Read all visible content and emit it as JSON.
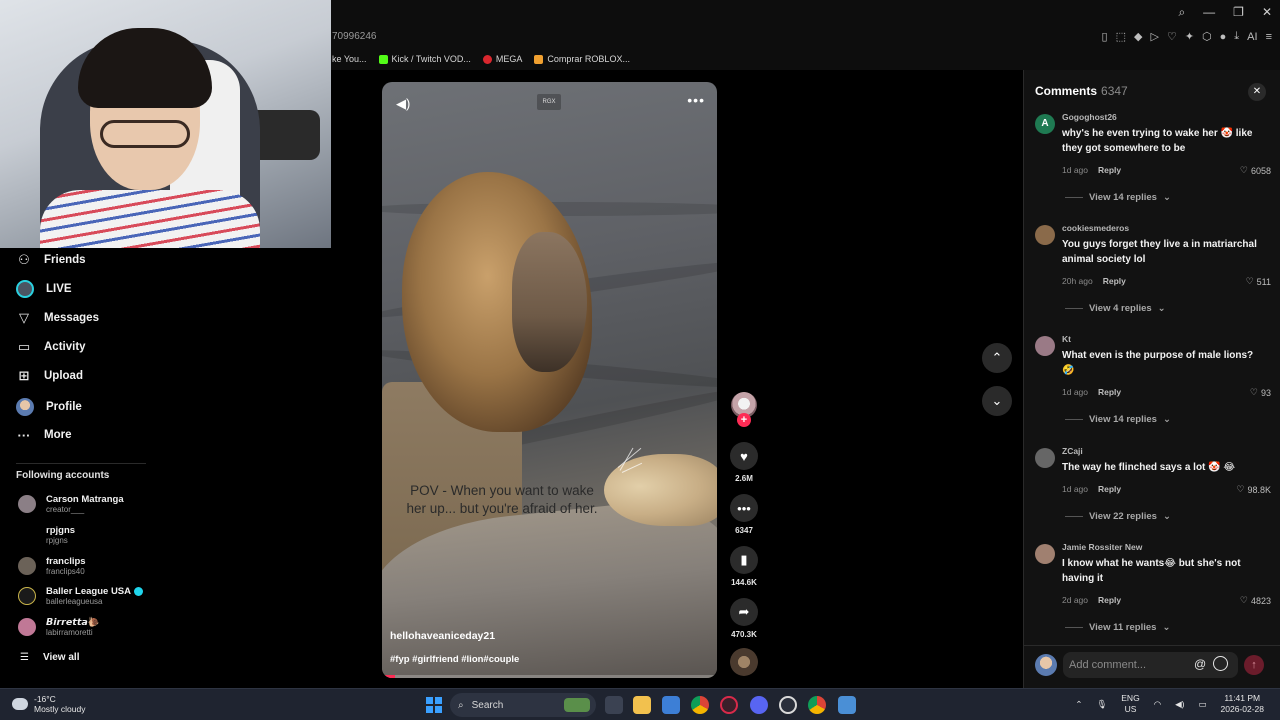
{
  "browser": {
    "url_fragment": "70996246",
    "bookmarks": [
      {
        "label": "ke You...",
        "color": "#d8d8d8"
      },
      {
        "label": "Kick / Twitch VOD...",
        "color": "#53fc18"
      },
      {
        "label": "MEGA",
        "color": "#d9272e"
      },
      {
        "label": "Comprar ROBLOX...",
        "color": "#f0a030"
      }
    ],
    "toolbar_ai_label": "AI"
  },
  "sidebar": {
    "nav": [
      {
        "label": "Friends",
        "icon": "friends-icon"
      },
      {
        "label": "LIVE",
        "icon": "live-icon"
      },
      {
        "label": "Messages",
        "icon": "messages-icon"
      },
      {
        "label": "Activity",
        "icon": "activity-icon"
      },
      {
        "label": "Upload",
        "icon": "upload-icon"
      },
      {
        "label": "Profile",
        "icon": "profile-icon"
      },
      {
        "label": "More",
        "icon": "more-icon"
      }
    ],
    "following_title": "Following accounts",
    "accounts": [
      {
        "name": "Carson Matranga",
        "handle": "creator___",
        "verified": false,
        "color": "#8b7f86"
      },
      {
        "name": "rpjgns",
        "handle": "rpjgns",
        "verified": false,
        "color": "#000000"
      },
      {
        "name": "franclips",
        "handle": "franclips40",
        "verified": false,
        "color": "#6b6258"
      },
      {
        "name": "Baller League USA",
        "handle": "ballerleagueusa",
        "verified": true,
        "color": "#1a1a1a"
      },
      {
        "name": "𝘽𝙞𝙧𝙧𝙚𝙩𝙩𝙖🐌",
        "handle": "labirramoretti",
        "verified": false,
        "color": "#c07896"
      }
    ],
    "view_all": "View all"
  },
  "video": {
    "watermark": "RGX",
    "caption": "POV - When you want to wake her up... but you're afraid of her.",
    "author": "hellohaveaniceday21",
    "tags": "#fyp #girlfriend #lion#couple",
    "progress_fraction": 0.04
  },
  "actions": {
    "likes": "2.6M",
    "comments": "6347",
    "saves": "144.6K",
    "shares": "470.3K"
  },
  "comments_panel": {
    "title": "Comments",
    "count": "6347",
    "input_placeholder": "Add comment...",
    "items": [
      {
        "user": "Gogoghost26",
        "avatar_letter": "A",
        "avatar_color": "#1f7a52",
        "text": "why's he even trying to wake her 🤡 like they got somewhere to be",
        "time": "1d ago",
        "reply": "Reply",
        "likes": "6058",
        "view_replies": "View 14 replies"
      },
      {
        "user": "cookiesmederos",
        "avatar_letter": "",
        "avatar_color": "#8a6a4a",
        "text": "You guys forget they live a in matriarchal animal society lol",
        "time": "20h ago",
        "reply": "Reply",
        "likes": "511",
        "view_replies": "View 4 replies"
      },
      {
        "user": "Kt",
        "avatar_letter": "",
        "avatar_color": "#9a7a86",
        "text": "What even is the purpose of male lions? 🤣",
        "time": "1d ago",
        "reply": "Reply",
        "likes": "93",
        "view_replies": "View 14 replies"
      },
      {
        "user": "ZCaji",
        "avatar_letter": "",
        "avatar_color": "#666666",
        "text": "The way he flinched says a lot 🤡 😂",
        "time": "1d ago",
        "reply": "Reply",
        "likes": "98.8K",
        "view_replies": "View 22 replies"
      },
      {
        "user": "Jamie Rossiter New",
        "avatar_letter": "",
        "avatar_color": "#a08070",
        "text": "I know what he wants😂 but she's not having it",
        "time": "2d ago",
        "reply": "Reply",
        "likes": "4823",
        "view_replies": "View 11 replies"
      }
    ]
  },
  "taskbar": {
    "temperature": "-16°C",
    "weather": "Mostly cloudy",
    "search": "Search",
    "lang": "ENG",
    "region": "US",
    "time": "11:41 PM",
    "date": "2026-02-28"
  }
}
